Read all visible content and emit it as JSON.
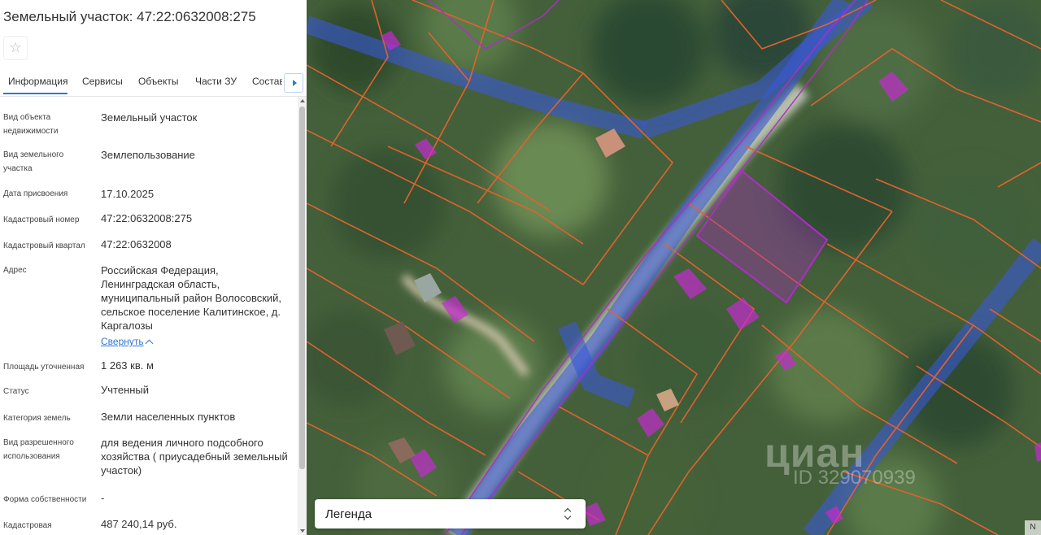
{
  "panel": {
    "title": "Земельный участок: 47:22:0632008:275",
    "favorite_icon": "star-outline-icon",
    "tabs": [
      {
        "label": "Информация",
        "active": true
      },
      {
        "label": "Сервисы"
      },
      {
        "label": "Объекты"
      },
      {
        "label": "Части ЗУ"
      },
      {
        "label": "Состав"
      }
    ],
    "tab_scroll_icon": "chevron-right-icon",
    "accent_color": "#2f77d4",
    "properties": [
      {
        "label": "Вид объекта недвижимости",
        "value": "Земельный участок"
      },
      {
        "label": "Вид земельного участка",
        "value": "Землепользование"
      },
      {
        "label": "Дата присвоения",
        "value": "17.10.2025"
      },
      {
        "label": "Кадастровый номер",
        "value": "47:22:0632008:275"
      },
      {
        "label": "Кадастровый квартал",
        "value": "47:22:0632008"
      },
      {
        "label": "Адрес",
        "value": "Российская Федерация, Ленинградская область, муниципальный район Волосовский, сельское поселение Калитинское, д. Каргалозы",
        "link": "Свернуть"
      },
      {
        "label": "Площадь уточненная",
        "value": "1 263 кв. м"
      },
      {
        "label": "Статус",
        "value": "Учтенный"
      },
      {
        "label": "Категория земель",
        "value": "Земли населенных пунктов"
      },
      {
        "label": "Вид разрешенного использования",
        "value": "для ведения личного подсобного хозяйства ( приусадебный земельный участок)"
      },
      {
        "label": "Форма собственности",
        "value": "-"
      },
      {
        "label": "Кадастровая",
        "value": "487 240,14 руб."
      }
    ]
  },
  "map": {
    "legend_label": "Легенда",
    "legend_icon": "chevron-up-down-icon",
    "watermark": "циан",
    "watermark_id": "ID 329070939",
    "corner_label": "N",
    "parcel_border_color": "#e0622e",
    "selected_parcel_color": "#b02cc8",
    "building_color": "#c42bd0",
    "zone_color": "#3a59d6"
  }
}
